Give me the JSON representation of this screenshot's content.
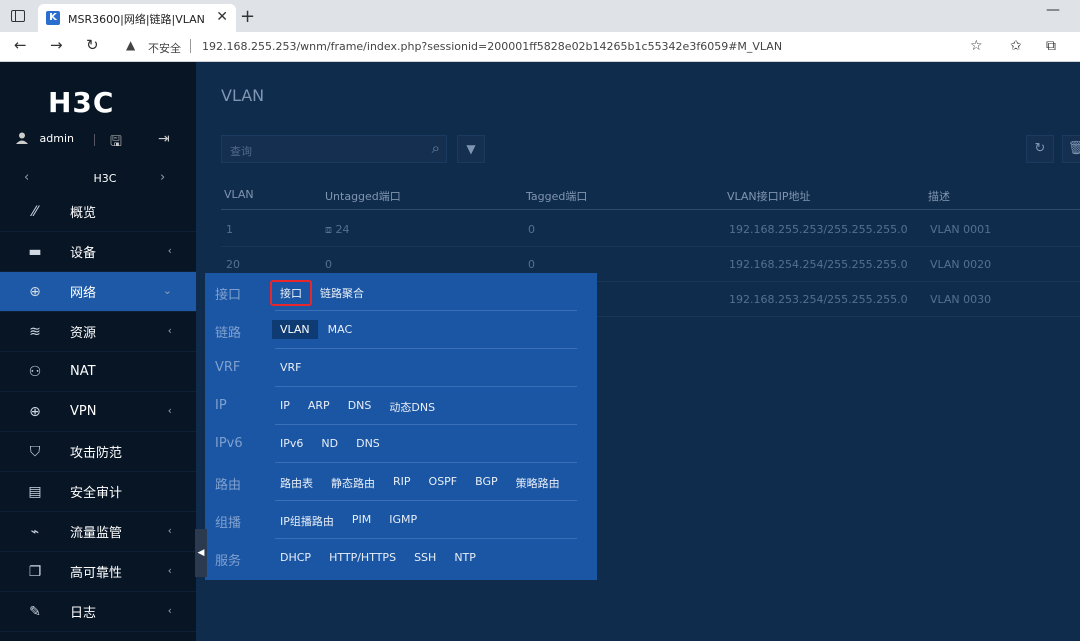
{
  "browser": {
    "tab_title": "MSR3600|网络|链路|VLAN",
    "favicon_text": "K",
    "close_glyph": "✕",
    "newtab_glyph": "+",
    "insecure_label": "不安全",
    "url": "192.168.255.253/wnm/frame/index.php?sessionid=200001ff5828e02b14265b1c55342e3f6059#M_VLAN"
  },
  "sidebar": {
    "logo": "H3C",
    "user": "admin",
    "device": "H3C",
    "items": [
      {
        "label": "概览",
        "icon": "dashboard-icon",
        "glyph": "⁄⁄",
        "chevron": ""
      },
      {
        "label": "设备",
        "icon": "device-icon",
        "glyph": "▬",
        "chevron": "‹"
      },
      {
        "label": "网络",
        "icon": "globe-icon",
        "glyph": "⊕",
        "chevron": "⌄"
      },
      {
        "label": "资源",
        "icon": "database-icon",
        "glyph": "≋",
        "chevron": "‹"
      },
      {
        "label": "NAT",
        "icon": "nat-icon",
        "glyph": "⚇",
        "chevron": ""
      },
      {
        "label": "VPN",
        "icon": "vpn-icon",
        "glyph": "⊕",
        "chevron": "‹"
      },
      {
        "label": "攻击防范",
        "icon": "shield-icon",
        "glyph": "⛉",
        "chevron": ""
      },
      {
        "label": "安全审计",
        "icon": "audit-icon",
        "glyph": "▤",
        "chevron": ""
      },
      {
        "label": "流量监管",
        "icon": "traffic-icon",
        "glyph": "⌁",
        "chevron": "‹"
      },
      {
        "label": "高可靠性",
        "icon": "reliability-icon",
        "glyph": "❐",
        "chevron": "‹"
      },
      {
        "label": "日志",
        "icon": "log-icon",
        "glyph": "✎",
        "chevron": "‹"
      }
    ]
  },
  "main": {
    "title": "VLAN",
    "search_placeholder": "查询",
    "columns": [
      "VLAN",
      "Untagged端口",
      "Tagged端口",
      "VLAN接口IP地址",
      "描述"
    ],
    "rows": [
      [
        "1",
        "⧈ 24",
        "0",
        "192.168.255.253/255.255.255.0",
        "VLAN 0001"
      ],
      [
        "20",
        "0",
        "0",
        "192.168.254.254/255.255.255.0",
        "VLAN 0020"
      ],
      [
        "",
        "",
        "",
        "192.168.253.254/255.255.255.0",
        "VLAN 0030"
      ]
    ]
  },
  "nav_panel": {
    "rows": [
      {
        "category": "接口",
        "links": [
          "接口",
          "链路聚合"
        ]
      },
      {
        "category": "链路",
        "links": [
          "VLAN",
          "MAC"
        ]
      },
      {
        "category": "VRF",
        "links": [
          "VRF"
        ]
      },
      {
        "category": "IP",
        "links": [
          "IP",
          "ARP",
          "DNS",
          "动态DNS"
        ]
      },
      {
        "category": "IPv6",
        "links": [
          "IPv6",
          "ND",
          "DNS"
        ]
      },
      {
        "category": "路由",
        "links": [
          "路由表",
          "静态路由",
          "RIP",
          "OSPF",
          "BGP",
          "策略路由"
        ]
      },
      {
        "category": "组播",
        "links": [
          "IP组播路由",
          "PIM",
          "IGMP"
        ]
      },
      {
        "category": "服务",
        "links": [
          "DHCP",
          "HTTP/HTTPS",
          "SSH",
          "NTP"
        ]
      }
    ]
  }
}
